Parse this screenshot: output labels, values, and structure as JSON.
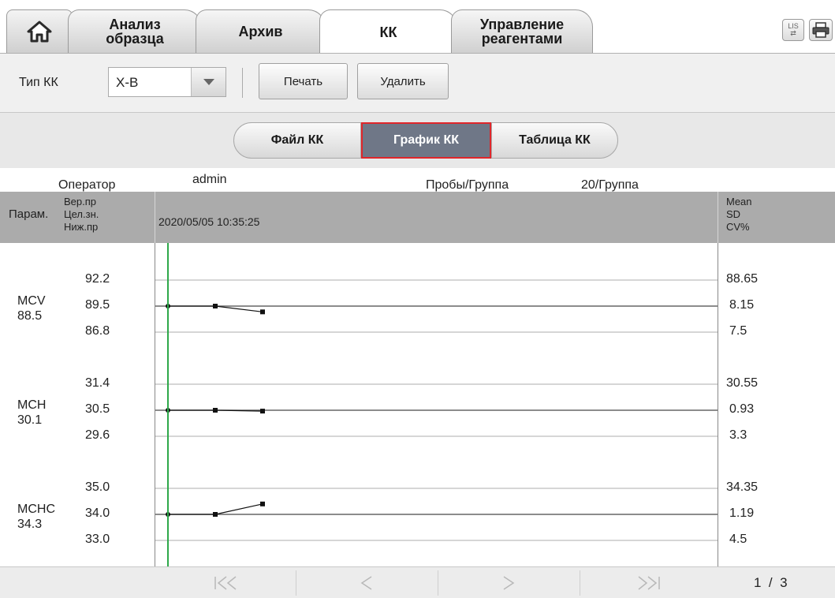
{
  "tabs": [
    {
      "label": "Анализ\nобразца",
      "active": false
    },
    {
      "label": "Архив",
      "active": false
    },
    {
      "label": "КК",
      "active": true
    },
    {
      "label": "Управление\nреагентами",
      "active": false
    }
  ],
  "top_icons": {
    "lis": "LIS",
    "lis_icon": "lis-transfer-icon",
    "print_icon": "printer-icon",
    "home_icon": "home-icon"
  },
  "toolbar": {
    "qc_type_label": "Тип КК",
    "qc_type_value": "X-B",
    "print_label": "Печать",
    "delete_label": "Удалить"
  },
  "segments": [
    {
      "label": "Файл КК",
      "active": false
    },
    {
      "label": "График КК",
      "active": true
    },
    {
      "label": "Таблица КК",
      "active": false
    }
  ],
  "info": {
    "operator_label": "Оператор",
    "operator_value": "admin",
    "samples_label": "Пробы/Группа",
    "samples_value": "20/Группа"
  },
  "grid_header": {
    "param": "Парам.",
    "limits": [
      "Вер.пр",
      "Цел.зн.",
      "Ниж.пр"
    ],
    "timestamp": "2020/05/05 10:35:25",
    "stats": [
      "Mean",
      "SD",
      "CV%"
    ]
  },
  "chart_data": {
    "type": "line",
    "params": [
      {
        "name": "MCV",
        "target_value": "88.5",
        "upper": "92.2",
        "target": "89.5",
        "lower": "86.8",
        "points": [
          89.5,
          89.5,
          88.9
        ],
        "mean": "88.65",
        "sd": "8.15",
        "cv": "7.5"
      },
      {
        "name": "MCH",
        "target_value": "30.1",
        "upper": "31.4",
        "target": "30.5",
        "lower": "29.6",
        "points": [
          30.5,
          30.5,
          30.47
        ],
        "mean": "30.55",
        "sd": "0.93",
        "cv": "3.3"
      },
      {
        "name": "MCHC",
        "target_value": "34.3",
        "upper": "35.0",
        "target": "34.0",
        "lower": "33.0",
        "points": [
          34.0,
          34.0,
          34.4
        ],
        "mean": "34.35",
        "sd": "1.19",
        "cv": "4.5"
      }
    ],
    "cursor_color": "#2ea84a"
  },
  "footer": {
    "nav": [
      "first-page-icon",
      "prev-page-icon",
      "next-page-icon",
      "last-page-icon"
    ],
    "page_current": "1",
    "page_sep": "/",
    "page_total": "3"
  }
}
